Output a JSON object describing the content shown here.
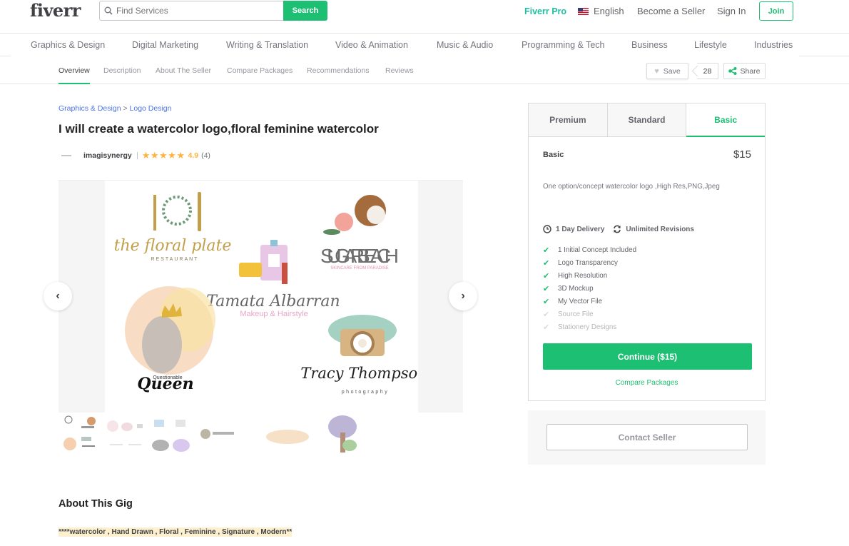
{
  "header": {
    "logo": "fiverr",
    "search_placeholder": "Find Services",
    "search_button": "Search",
    "fiverr_pro": "Fiverr Pro",
    "language": "English",
    "become_seller": "Become a Seller",
    "sign_in": "Sign In",
    "join": "Join"
  },
  "categories": [
    "Graphics & Design",
    "Digital Marketing",
    "Writing & Translation",
    "Video & Animation",
    "Music & Audio",
    "Programming & Tech",
    "Business",
    "Lifestyle",
    "Industries"
  ],
  "subnav": {
    "items": [
      "Overview",
      "Description",
      "About The Seller",
      "Compare Packages",
      "Recommendations",
      "Reviews"
    ],
    "active": "Overview",
    "save": "Save",
    "save_count": "28",
    "share": "Share"
  },
  "gig": {
    "breadcrumb": [
      "Graphics & Design",
      "Logo Design"
    ],
    "breadcrumb_sep": ">",
    "title": "I will create a watercolor logo,floral feminine watercolor",
    "seller": "imagisynergy",
    "stars": "★★★★★",
    "rating": "4.9",
    "review_count": "(4)",
    "gallery_logos": {
      "floral_plate": "the floral plate",
      "floral_plate_sub": "RESTAURANT",
      "sugar_beach": "SUGAR BEACH",
      "sugar_beach_sub": "SKINCARE FROM PARADISE",
      "tamata": "Tamata Albarran",
      "tamata_sub": "Makeup & Hairstyle",
      "queen_small": "Questionable",
      "queen": "Queen",
      "tracy": "Tracy Thompson",
      "tracy_sub": "photography"
    },
    "prev_label": "‹",
    "next_label": "›",
    "about_heading": "About This Gig",
    "about_tags": "****watercolor , Hand Drawn , Floral , Feminine , Signature , Modern**"
  },
  "package": {
    "tabs": [
      "Premium",
      "Standard",
      "Basic"
    ],
    "active_tab": "Basic",
    "name": "Basic",
    "price": "$15",
    "description": "One option/concept watercolor logo ,High Res,PNG,Jpeg",
    "delivery": "1 Day Delivery",
    "revisions": "Unlimited Revisions",
    "features": [
      {
        "label": "1 Initial Concept Included",
        "included": true
      },
      {
        "label": "Logo Transparency",
        "included": true
      },
      {
        "label": "High Resolution",
        "included": true
      },
      {
        "label": "3D Mockup",
        "included": true
      },
      {
        "label": "My Vector File",
        "included": true
      },
      {
        "label": "Source File",
        "included": false
      },
      {
        "label": "Stationery Designs",
        "included": false
      }
    ],
    "continue_label": "Continue ($15)",
    "compare_label": "Compare Packages",
    "contact_label": "Contact Seller"
  },
  "colors": {
    "brand_green": "#1dbf73",
    "pro_teal": "#1dbf9f",
    "star_gold": "#ffb33e",
    "link_blue": "#4a73e8"
  }
}
